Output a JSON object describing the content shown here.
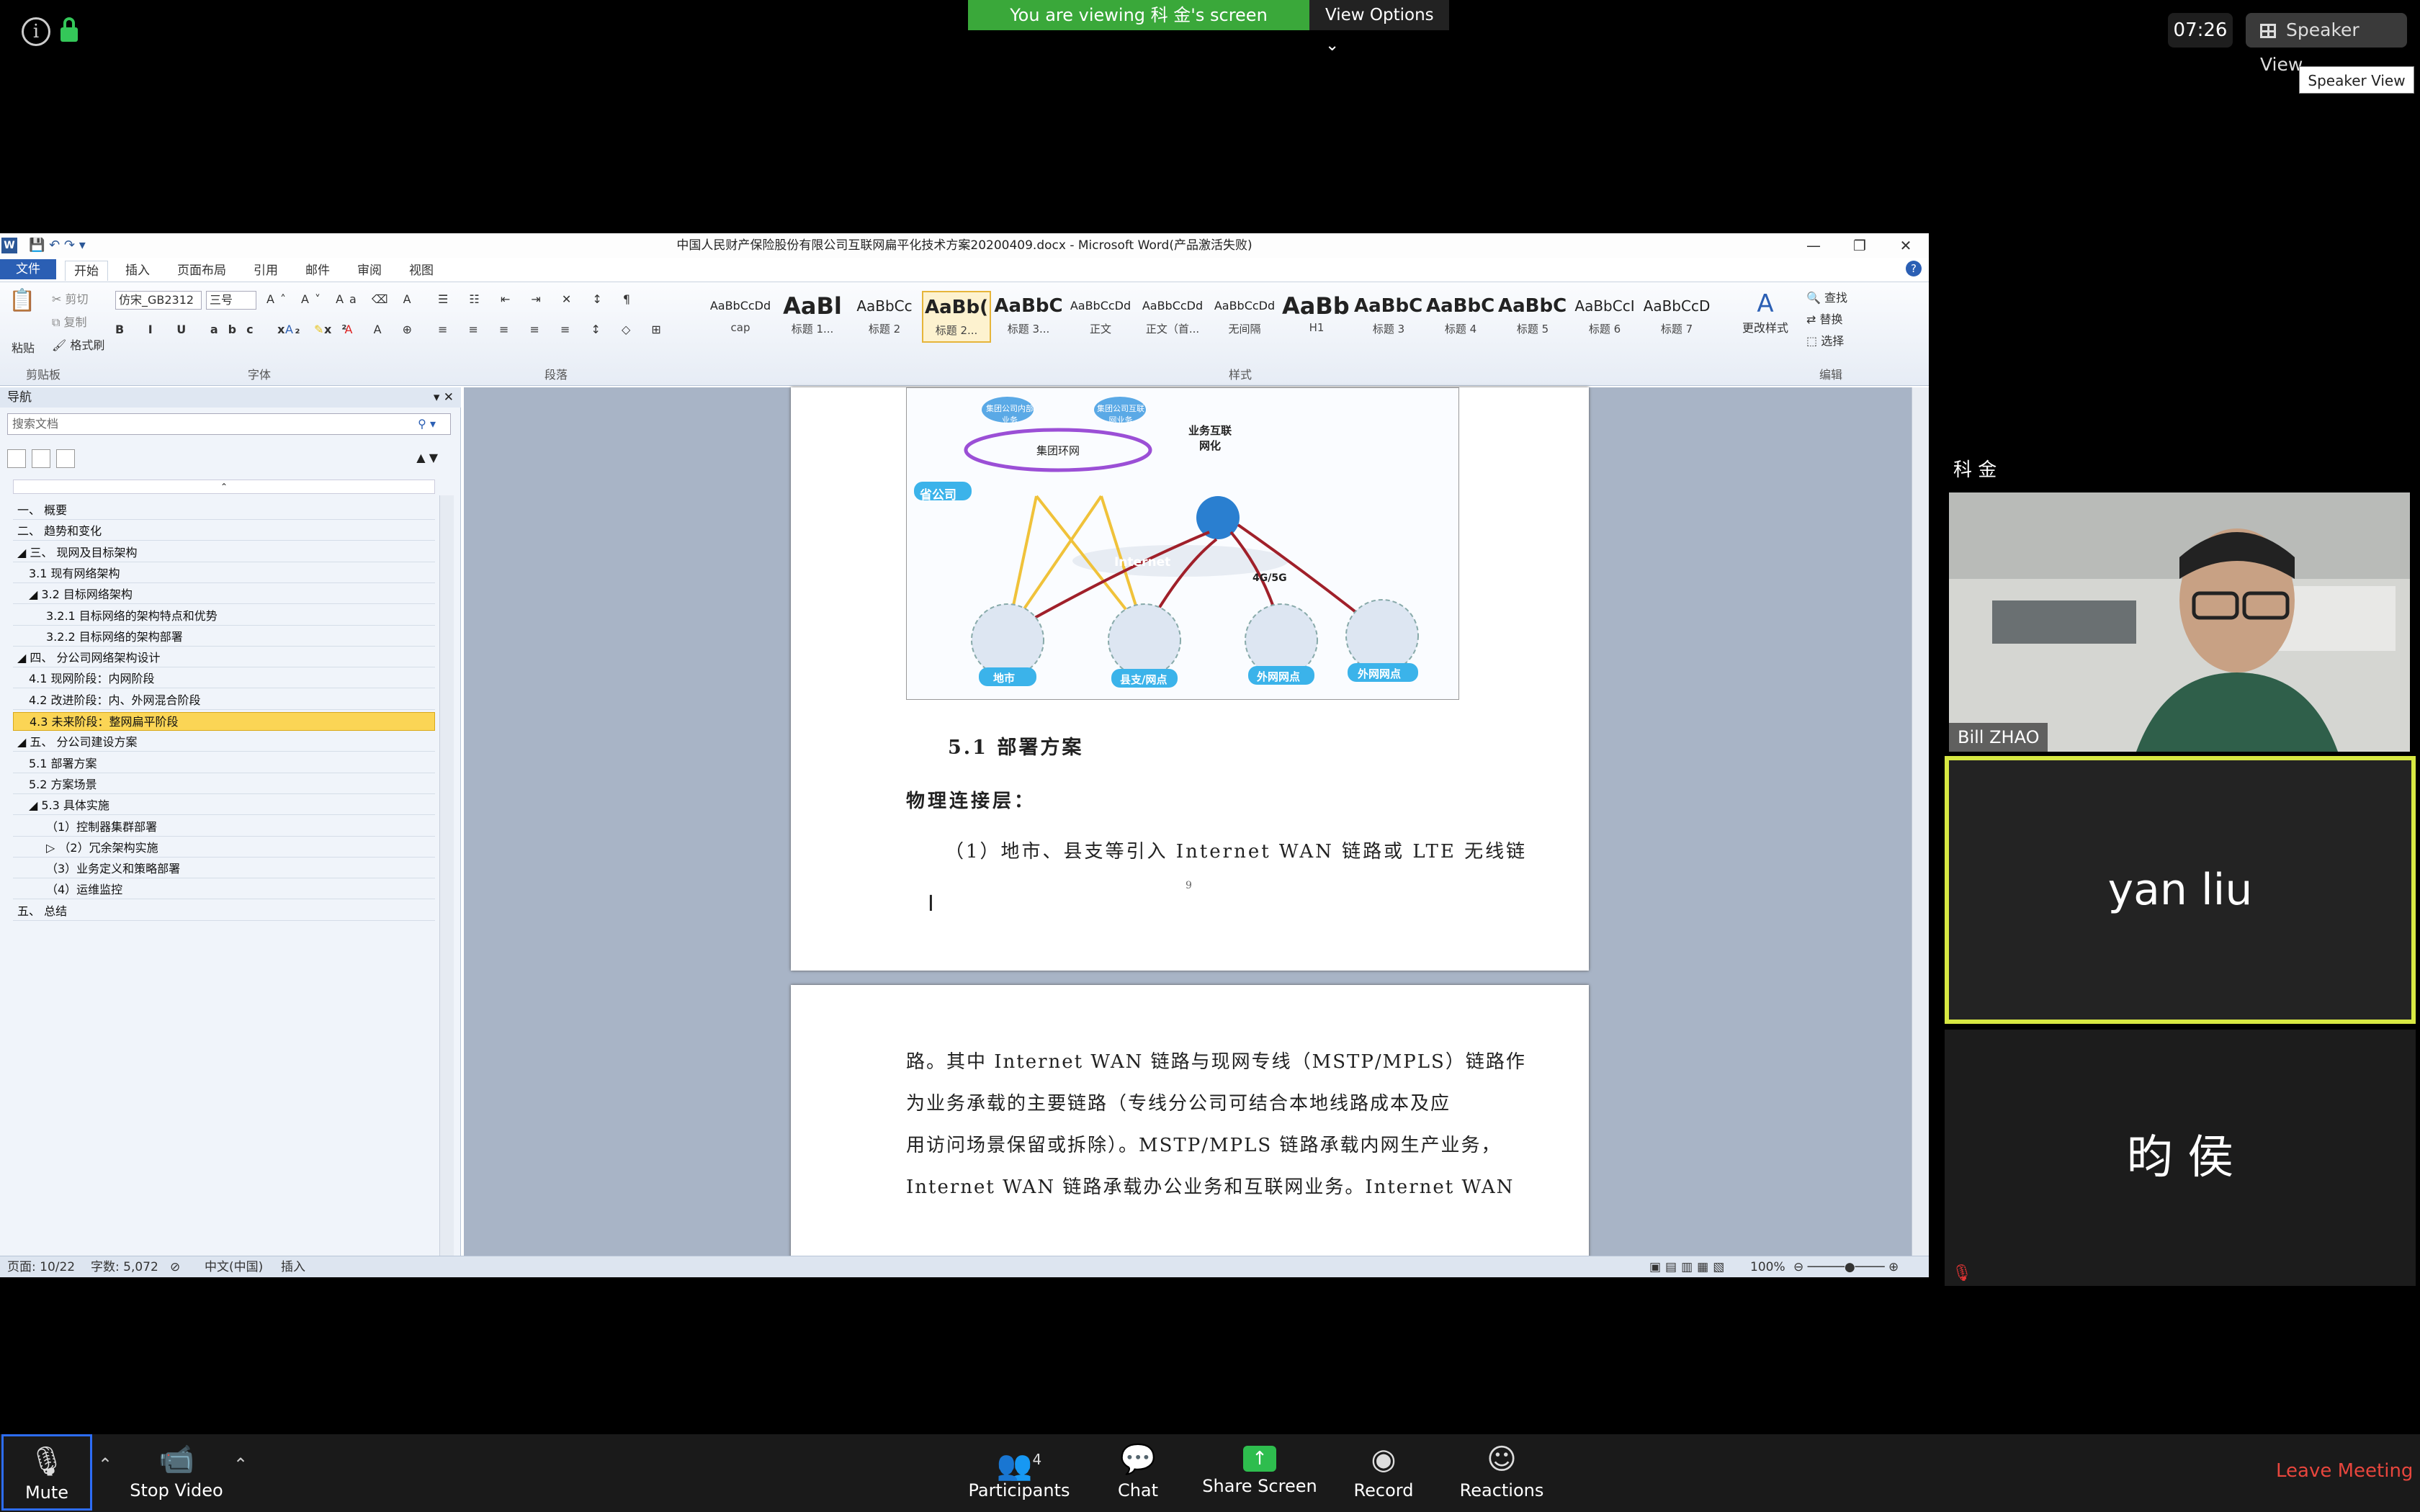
{
  "meeting": {
    "viewing_banner": "You are viewing 科 金's screen",
    "view_options": "View Options",
    "clock": "07:26",
    "speaker_view": "Speaker View",
    "speaker_view_tooltip": "Speaker View"
  },
  "word": {
    "title": "中国人民财产保险股份有限公司互联网扁平化技术方案20200409.docx - Microsoft Word(产品激活失败)",
    "tabs": [
      "文件",
      "开始",
      "插入",
      "页面布局",
      "引用",
      "邮件",
      "审阅",
      "视图"
    ],
    "clipboard": {
      "paste": "粘贴",
      "cut": "剪切",
      "copy": "复制",
      "format_painter": "格式刷",
      "label": "剪贴板"
    },
    "font": {
      "name": "仿宋_GB2312",
      "size": "三号",
      "label": "字体"
    },
    "paragraph_label": "段落",
    "styles_label": "样式",
    "styles": [
      {
        "sample": "AaBbCcDd",
        "name": "cap"
      },
      {
        "sample": "AaBl",
        "name": "标题 1..."
      },
      {
        "sample": "AaBbCc",
        "name": "标题 2"
      },
      {
        "sample": "AaBb(",
        "name": "标题 2..."
      },
      {
        "sample": "AaBbC",
        "name": "标题 3..."
      },
      {
        "sample": "AaBbCcDd",
        "name": "正文"
      },
      {
        "sample": "AaBbCcDd",
        "name": "正文（首..."
      },
      {
        "sample": "AaBbCcDd",
        "name": "无间隔"
      },
      {
        "sample": "AaBb(",
        "name": "H1"
      },
      {
        "sample": "AaBbCc",
        "name": "标题 3"
      },
      {
        "sample": "AaBbCc",
        "name": "标题 4"
      },
      {
        "sample": "AaBbCc",
        "name": "标题 5"
      },
      {
        "sample": "AaBbCcI",
        "name": "标题 6"
      },
      {
        "sample": "AaBbCcD",
        "name": "标题 7"
      }
    ],
    "change_styles": "更改样式",
    "editing": {
      "find": "查找",
      "replace": "替换",
      "select": "选择",
      "label": "编辑"
    },
    "nav": {
      "title": "导航",
      "search_placeholder": "搜索文档",
      "items": [
        {
          "text": "一、 概要"
        },
        {
          "text": "二、 趋势和变化"
        },
        {
          "text": "◢ 三、 现网及目标架构"
        },
        {
          "text": "3.1 现有网络架构"
        },
        {
          "text": "◢ 3.2 目标网络架构"
        },
        {
          "text": "3.2.1 目标网络的架构特点和优势"
        },
        {
          "text": "3.2.2 目标网络的架构部署"
        },
        {
          "text": "◢ 四、 分公司网络架构设计"
        },
        {
          "text": "4.1 现网阶段：内网阶段"
        },
        {
          "text": "4.2 改进阶段：内、外网混合阶段"
        },
        {
          "text": "4.3 未来阶段：整网扁平阶段"
        },
        {
          "text": "◢ 五、 分公司建设方案"
        },
        {
          "text": "5.1 部署方案"
        },
        {
          "text": "5.2 方案场景"
        },
        {
          "text": "◢ 5.3 具体实施"
        },
        {
          "text": "（1）控制器集群部署"
        },
        {
          "text": "▷ （2）冗余架构实施"
        },
        {
          "text": "（3）业务定义和策略部署"
        },
        {
          "text": "（4）运维监控"
        },
        {
          "text": "五、 总结"
        }
      ]
    },
    "diagram": {
      "cloud1": "集团公司内部业务",
      "cloud2": "集团公司互联网业务",
      "ring": "集团环网",
      "biz": "业务互联网化",
      "province": "省公司",
      "internet": "Internet",
      "lte": "4G/5G",
      "site1": "地市",
      "site2": "县支/网点",
      "site3": "外网网点",
      "site4": "外网网点"
    },
    "doc": {
      "heading": "5.1 部署方案",
      "subheading": "物理连接层：",
      "line1": "（1）地市、县支等引入 Internet WAN 链路或 LTE 无线链",
      "page_num": "9",
      "p2_lines": [
        "路。其中 Internet WAN 链路与现网专线（MSTP/MPLS）链路作",
        "为业务承载的主要链路（专线分公司可结合本地线路成本及应",
        "用访问场景保留或拆除）。MSTP/MPLS 链路承载内网生产业务，",
        "Internet WAN 链路承载办公业务和互联网业务。Internet WAN"
      ]
    },
    "status": {
      "page": "页面: 10/22",
      "words": "字数: 5,072",
      "lang": "中文(中国)",
      "mode": "插入",
      "zoom": "100%"
    }
  },
  "participants": {
    "presenter_label": "科 金",
    "video_name": "Bill ZHAO",
    "tile2": "yan liu",
    "tile3": "昀 侯"
  },
  "toolbar": {
    "mute": "Mute",
    "stop_video": "Stop Video",
    "participants": "Participants",
    "participants_count": "4",
    "chat": "Chat",
    "share": "Share Screen",
    "record": "Record",
    "reactions": "Reactions",
    "leave": "Leave Meeting"
  },
  "colors": {
    "banner": "#3aa83a",
    "active_tile": "#d7e842",
    "leave": "#e8463d",
    "nav_selected": "#fbd555",
    "word_blue": "#2b5fb4"
  }
}
